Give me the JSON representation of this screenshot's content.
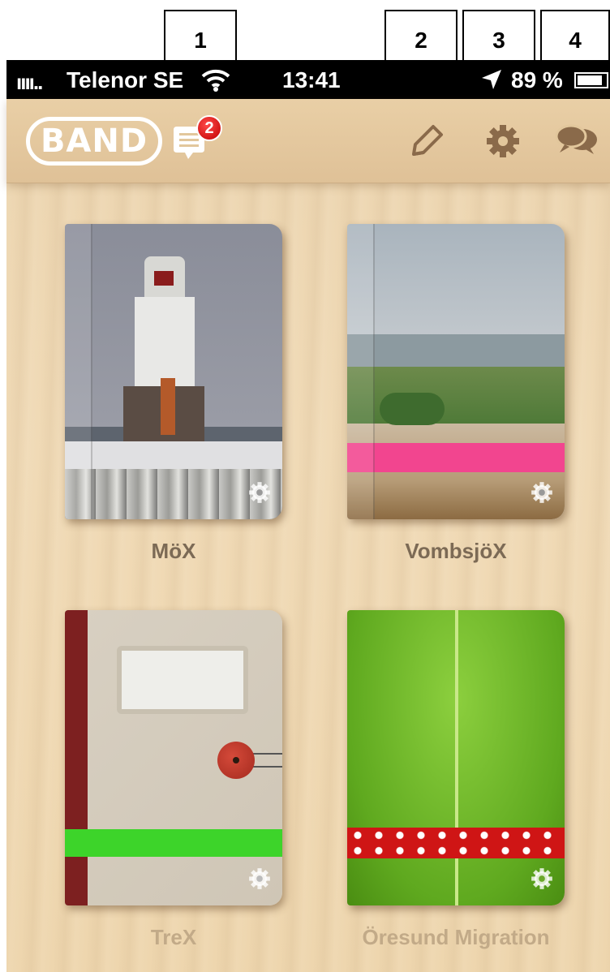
{
  "annotations": [
    {
      "label": "1"
    },
    {
      "label": "2"
    },
    {
      "label": "3"
    },
    {
      "label": "4"
    }
  ],
  "status_bar": {
    "signal": "ıııı..",
    "carrier": "Telenor SE",
    "time": "13:41",
    "battery_text": "89 %",
    "battery_level": 0.89
  },
  "header": {
    "logo": "BAND",
    "notification_count": "2",
    "icons": [
      "notifications-icon",
      "pencil-icon",
      "gear-icon",
      "chat-bubbles-icon"
    ]
  },
  "bands": [
    {
      "title": "MöX",
      "cover": "lighthouse photo",
      "band_color": "#e0e0e2"
    },
    {
      "title": "VombsjöX",
      "cover": "shore photo",
      "band_color": "#f2458f"
    },
    {
      "title": "TreX",
      "cover": "notebook",
      "band_color": "#3dd42a"
    },
    {
      "title": "Öresund Migration",
      "cover": "green leaf",
      "band_color": "#cf1515"
    }
  ],
  "colors": {
    "status_bar": "#000000",
    "wood": "#eed6ae",
    "badge": "#d40000"
  }
}
